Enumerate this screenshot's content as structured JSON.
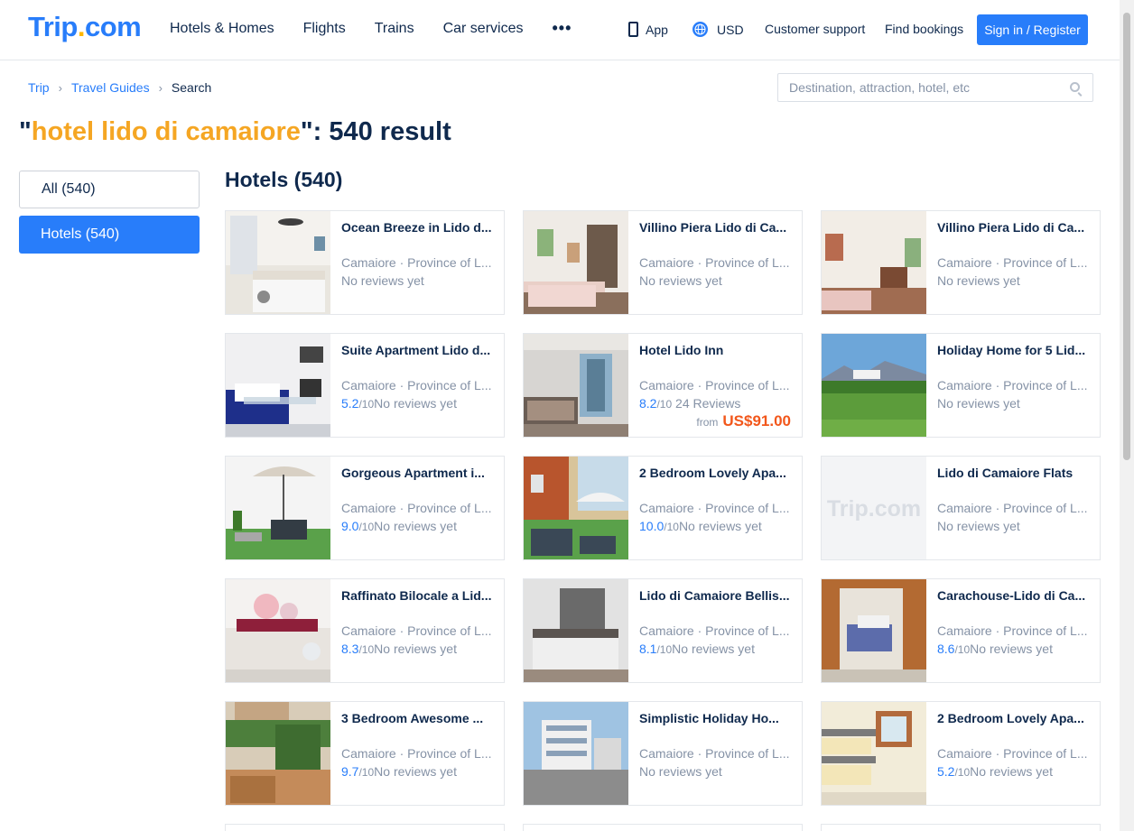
{
  "header": {
    "logo_main": "Trip",
    "logo_dot": ".",
    "logo_suffix": "com",
    "nav": [
      "Hotels & Homes",
      "Flights",
      "Trains",
      "Car services"
    ],
    "more": "•••",
    "app": "App",
    "currency": "USD",
    "support": "Customer support",
    "bookings": "Find bookings",
    "signin": "Sign in / Register"
  },
  "breadcrumb": {
    "trip": "Trip",
    "guides": "Travel Guides",
    "current": "Search",
    "sep": "›"
  },
  "search": {
    "placeholder": "Destination, attraction, hotel, etc"
  },
  "title": {
    "open": "\"",
    "keyword": "hotel lido di camaiore",
    "close": "\": 540 result"
  },
  "filters": {
    "all": "All (540)",
    "hotels": "Hotels (540)"
  },
  "section": "Hotels (540)",
  "placeholder_text": "Trip.com",
  "colors": {
    "brand": "#287dfa",
    "accent": "#f5a623",
    "price": "#f2571b"
  },
  "hotels": [
    {
      "name": "Ocean Breeze in Lido d...",
      "location": "Camaiore · Province of L...",
      "score": "",
      "max": "",
      "reviews": "No reviews yet"
    },
    {
      "name": "Villino Piera Lido di Ca...",
      "location": "Camaiore · Province of L...",
      "score": "",
      "max": "",
      "reviews": "No reviews yet"
    },
    {
      "name": "Villino Piera Lido di Ca...",
      "location": "Camaiore · Province of L...",
      "score": "",
      "max": "",
      "reviews": "No reviews yet"
    },
    {
      "name": "Suite Apartment Lido d...",
      "location": "Camaiore · Province of L...",
      "score": "5.2",
      "max": "/10",
      "reviews": "No reviews yet"
    },
    {
      "name": "Hotel Lido Inn",
      "location": "Camaiore · Province of L...",
      "score": "8.2",
      "max": "/10",
      "reviews": " 24 Reviews",
      "price_from": "from",
      "price": "US$91.00"
    },
    {
      "name": "Holiday Home for 5 Lid...",
      "location": "Camaiore · Province of L...",
      "score": "",
      "max": "",
      "reviews": "No reviews yet"
    },
    {
      "name": "Gorgeous Apartment i...",
      "location": "Camaiore · Province of L...",
      "score": "9.0",
      "max": "/10",
      "reviews": "No reviews yet"
    },
    {
      "name": "2 Bedroom Lovely Apa...",
      "location": "Camaiore · Province of L...",
      "score": "10.0",
      "max": "/10",
      "reviews": "No reviews yet"
    },
    {
      "name": "Lido di Camaiore Flats",
      "location": "Camaiore · Province of L...",
      "score": "",
      "max": "",
      "reviews": "No reviews yet"
    },
    {
      "name": "Raffinato Bilocale a Lid...",
      "location": "Camaiore · Province of L...",
      "score": "8.3",
      "max": "/10",
      "reviews": "No reviews yet"
    },
    {
      "name": "Lido di Camaiore Bellis...",
      "location": "Camaiore · Province of L...",
      "score": "8.1",
      "max": "/10",
      "reviews": "No reviews yet"
    },
    {
      "name": "Carachouse-Lido di Ca...",
      "location": "Camaiore · Province of L...",
      "score": "8.6",
      "max": "/10",
      "reviews": "No reviews yet"
    },
    {
      "name": "3 Bedroom Awesome ...",
      "location": "Camaiore · Province of L...",
      "score": "9.7",
      "max": "/10",
      "reviews": "No reviews yet"
    },
    {
      "name": "Simplistic Holiday Ho...",
      "location": "Camaiore · Province of L...",
      "score": "",
      "max": "",
      "reviews": "No reviews yet"
    },
    {
      "name": "2 Bedroom Lovely Apa...",
      "location": "Camaiore · Province of L...",
      "score": "5.2",
      "max": "/10",
      "reviews": "No reviews yet"
    }
  ]
}
